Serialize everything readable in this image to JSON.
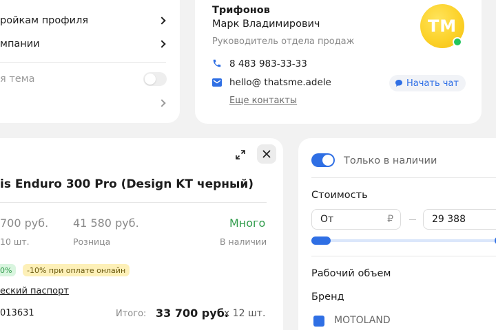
{
  "settings_card": {
    "items": [
      {
        "label": "ройкам профиля"
      },
      {
        "label": "мпании"
      }
    ],
    "dark_theme_label": "я тема",
    "dark_theme_on": false
  },
  "contact_card": {
    "last_name": "Трифонов",
    "first_name": "Марк Владимирович",
    "role": "Руководитель отдела продаж",
    "avatar_initials": "ТМ",
    "status": "online",
    "phone": "8 483 983-33-33",
    "email": "hello@ thatsme.adele",
    "chat_button": "Начать чат",
    "more_contacts": "Еще контакты"
  },
  "product_card": {
    "title": "is Enduro 300 Pro (Design KT черный)",
    "price_wholesale": "700 руб.",
    "min_qty": "10 шт.",
    "price_retail": "41 580 руб.",
    "retail_label": "Розница",
    "stock_value": "Много",
    "stock_label": "В наличии",
    "badge_discount": "0%",
    "badge_online": "-10% при оплате онлайн",
    "passport_link": "еский паспорт",
    "article": "013631",
    "total_label": "Итого:",
    "total_value": "33 700 руб.",
    "total_qty": "x 12 шт."
  },
  "filter_card": {
    "in_stock_label": "Только в наличии",
    "in_stock_on": true,
    "price_title": "Стоимость",
    "price_from_placeholder": "От",
    "currency": "₽",
    "price_to_value": "29 388",
    "volume_title": "Рабочий объем",
    "brand_title": "Бренд",
    "brand_option": "MOTOLAND",
    "brand_checked": true
  },
  "colors": {
    "accent": "#2f6fe4",
    "success": "#2f9b4a",
    "badge_green_bg": "#d9f5df",
    "badge_yellow_bg": "#fdf0b8",
    "avatar": "#fcd22a"
  }
}
